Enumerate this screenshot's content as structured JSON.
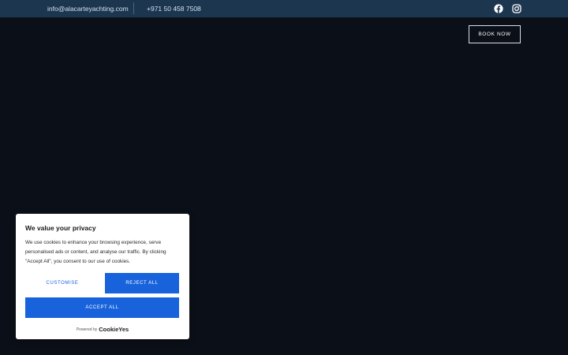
{
  "topbar": {
    "email": "info@alacarteyachting.com",
    "phone": "+971 50 458 7508",
    "icons": [
      "facebook-icon",
      "instagram-icon"
    ]
  },
  "header": {
    "book_now": "BOOK NOW"
  },
  "cookie_banner": {
    "title": "We value your privacy",
    "description": "We use cookies to enhance your browsing experience, serve personalised ads or content, and analyse our traffic. By clicking \"Accept All\", you consent to our use of cookies.",
    "customise_label": "CUSTOMISE",
    "reject_label": "REJECT ALL",
    "accept_label": "ACCEPT ALL",
    "powered_by": "Powered by",
    "brand": "CookieYes"
  },
  "colors": {
    "topbar_bg": "#1c3650",
    "page_bg": "#0b0f17",
    "accent_blue": "#1863dc"
  }
}
